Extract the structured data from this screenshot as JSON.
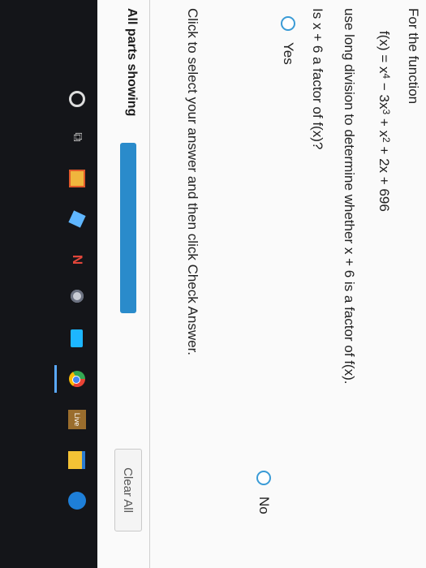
{
  "problem": {
    "intro": "For the function",
    "function": {
      "prefix": "f(x) = x",
      "exp1": "4",
      "term2": " − 3x",
      "exp2": "3",
      "term3": " + x",
      "exp3": "2",
      "rest": " + 2x + 696"
    },
    "instruction": "use long division to determine whether x + 6 is a factor of f(x).",
    "question": "Is x + 6 a factor of f(x)?",
    "choices": {
      "yes": "Yes",
      "no": "No"
    },
    "hint": "Click to select your answer and then click Check Answer."
  },
  "footer": {
    "parts_label": "All parts showing",
    "clear_all": "Clear All",
    "progress": 1.0
  },
  "taskbar": {
    "icons": [
      "start-icon",
      "task-view-icon",
      "store-icon",
      "app-icon",
      "app-n-icon",
      "app-icon",
      "mail-icon",
      "chrome-icon",
      "live-icon",
      "file-explorer-icon",
      "app-icon"
    ],
    "live_label": "Live",
    "app_n_label": "N",
    "taskview_glyph": "⧉"
  },
  "colors": {
    "accent": "#2a8bcb",
    "radio": "#3a9bd6",
    "taskbar": "#141519"
  }
}
